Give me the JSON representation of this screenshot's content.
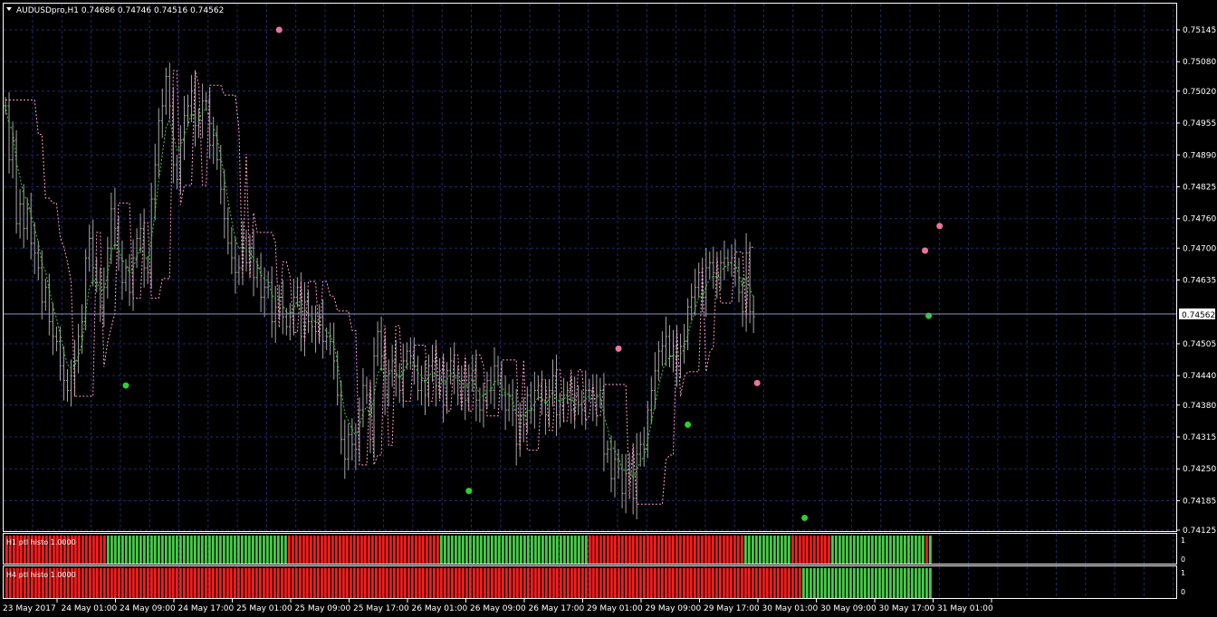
{
  "window": {
    "symbol_title": "AUDUSDpro,H1  0.74686 0.74746 0.74516 0.74562",
    "current_price": "0.74562"
  },
  "colors": {
    "background": "#000000",
    "grid": "#1f2a6b",
    "bars": "#a6a6a6",
    "fast_line": "#33cc33",
    "slow_line": "#ff99cc",
    "dot_high": "#e9759a",
    "dot_low": "#2fcf2f",
    "histo_red": "#ff1a1a",
    "histo_green": "#44cc44",
    "label_bg": "#ffffff"
  },
  "price_axis": {
    "ticks": [
      "0.75145",
      "0.75080",
      "0.75020",
      "0.74955",
      "0.74890",
      "0.74825",
      "0.74760",
      "0.74700",
      "0.74635",
      "0.74562",
      "0.74505",
      "0.74440",
      "0.74380",
      "0.74315",
      "0.74250",
      "0.74185",
      "0.74125"
    ]
  },
  "time_axis": {
    "labels": [
      "23 May 2017",
      "24 May 01:00",
      "24 May 09:00",
      "24 May 17:00",
      "25 May 01:00",
      "25 May 09:00",
      "25 May 17:00",
      "26 May 01:00",
      "26 May 09:00",
      "26 May 17:00",
      "29 May 01:00",
      "29 May 09:00",
      "29 May 17:00",
      "30 May 01:00",
      "30 May 09:00",
      "30 May 17:00",
      "31 May 01:00"
    ]
  },
  "indicators": [
    {
      "label": "H1 ptl histo 1.0000",
      "scale_top": "1",
      "scale_bottom": "0"
    },
    {
      "label": "H4 ptl histo 1.0000",
      "scale_top": "1",
      "scale_bottom": "0"
    }
  ],
  "chart_data": {
    "type": "line",
    "title": "AUDUSDpro,H1",
    "ylim": [
      0.74125,
      0.75145
    ],
    "closes": [
      0.7499,
      0.7488,
      0.7492,
      0.7475,
      0.7479,
      0.7474,
      0.7478,
      0.7471,
      0.7469,
      0.7466,
      0.7459,
      0.7462,
      0.7455,
      0.7452,
      0.7451,
      0.7446,
      0.7443,
      0.7441,
      0.7444,
      0.7447,
      0.7452,
      0.7455,
      0.7468,
      0.7472,
      0.7466,
      0.7463,
      0.7458,
      0.7462,
      0.747,
      0.7478,
      0.7474,
      0.7468,
      0.7463,
      0.7466,
      0.7461,
      0.7468,
      0.7472,
      0.7474,
      0.7466,
      0.7465,
      0.748,
      0.7487,
      0.7496,
      0.7499,
      0.7505,
      0.7499,
      0.7487,
      0.7484,
      0.7492,
      0.7497,
      0.7499,
      0.7502,
      0.7495,
      0.7496,
      0.75,
      0.75,
      0.7491,
      0.7493,
      0.7488,
      0.7482,
      0.7476,
      0.7471,
      0.7468,
      0.7465,
      0.7466,
      0.7472,
      0.7467,
      0.747,
      0.7464,
      0.7466,
      0.746,
      0.7462,
      0.7463,
      0.7455,
      0.7458,
      0.746,
      0.7456,
      0.7454,
      0.7456,
      0.746,
      0.7462,
      0.7452,
      0.7459,
      0.7455,
      0.7454,
      0.7453,
      0.7456,
      0.7451,
      0.7452,
      0.7451,
      0.7447,
      0.744,
      0.7431,
      0.7427,
      0.7432,
      0.743,
      0.7429,
      0.7437,
      0.7442,
      0.744,
      0.7431,
      0.7448,
      0.7453,
      0.7448,
      0.744,
      0.7445,
      0.7447,
      0.7444,
      0.7441,
      0.7447,
      0.7449,
      0.7448,
      0.7446,
      0.7441,
      0.7443,
      0.744,
      0.7446,
      0.7447,
      0.7442,
      0.7445,
      0.7438,
      0.7445,
      0.7447,
      0.7444,
      0.744,
      0.7443,
      0.7439,
      0.7444,
      0.7445,
      0.7439,
      0.7437,
      0.7439,
      0.7443,
      0.7441,
      0.7446,
      0.7444,
      0.744,
      0.7437,
      0.744,
      0.7437,
      0.743,
      0.7436,
      0.7434,
      0.744,
      0.7437,
      0.7441,
      0.7442,
      0.7439,
      0.7436,
      0.7441,
      0.7444,
      0.7436,
      0.7438,
      0.744,
      0.7441,
      0.7437,
      0.744,
      0.7438,
      0.7437,
      0.7441,
      0.7441,
      0.7438,
      0.744,
      0.7441,
      0.7428,
      0.7429,
      0.7423,
      0.7427,
      0.7425,
      0.742,
      0.7424,
      0.7426,
      0.7419,
      0.7428,
      0.743,
      0.7429,
      0.7437,
      0.7441,
      0.7445,
      0.7449,
      0.745,
      0.7452,
      0.7448,
      0.745,
      0.7446,
      0.745,
      0.7451,
      0.7458,
      0.746,
      0.7462,
      0.7465,
      0.746,
      0.7466,
      0.7467,
      0.7465,
      0.7464,
      0.7467,
      0.7468,
      0.7467,
      0.7468,
      0.7466,
      0.7461,
      0.7457,
      0.7469,
      0.7457,
      0.7456
    ],
    "high_dots": [
      [
        75,
        0.75145
      ],
      [
        168,
        0.74495
      ],
      [
        206,
        0.74425
      ],
      [
        252,
        0.74695
      ],
      [
        256,
        0.74745
      ]
    ],
    "low_dots": [
      [
        33,
        0.7442
      ],
      [
        127,
        0.74205
      ],
      [
        187,
        0.7434
      ],
      [
        219,
        0.7415
      ],
      [
        253,
        0.74562
      ]
    ],
    "h1_histo": "RRRRRRRRRRRRRRRRRRRRRRRRRRRRRRRRRRGGGGGGGGGGGGGGGGGGGGGGGGGGGGGGGGGGGGGGGGGGGGGGGGGGGGGGGGGGGGGGGRRRRRRRRRRRRRRRRRRRRRRRRRRRRRRRRRRRRRRRRRRRRRRRRRRRRGGGGGGGGGGGGGGGGGGGGGGGGGGGGGGGGGGGGGGGGGGGGGGGGGGGGRRRRRRRRRRRRRRRRRRRRRRRRRRRRRRRRRRRRRRRRRRRRRRRRRRRRRRGGGGGGGGGGGGGGGGRRRRRRRRRRRRRRGGGGGGGGGGGGGGGGGGGGGGGGGGGGGGGGRGR",
    "h4_histo_split": 0.858
  }
}
